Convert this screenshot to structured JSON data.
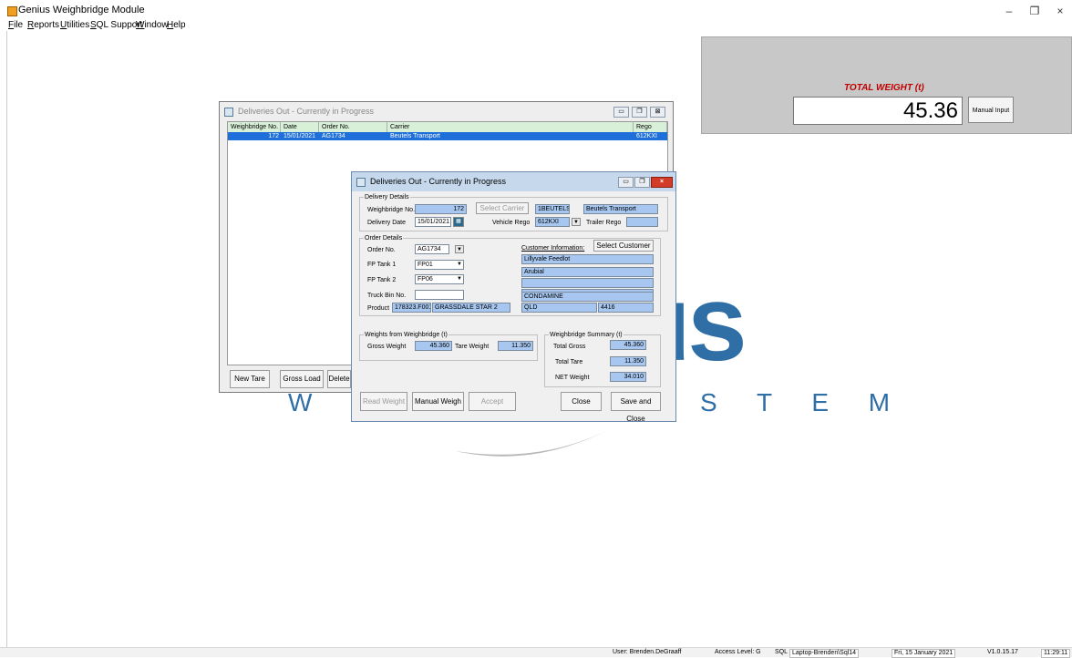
{
  "app": {
    "title": "Genius Weighbridge Module",
    "controls": {
      "minimize": "–",
      "restore": "❐",
      "close": "×"
    }
  },
  "menu": [
    "File",
    "Reports",
    "Utilities",
    "SQL Support",
    "Window",
    "Help"
  ],
  "weight_panel": {
    "label": "TOTAL WEIGHT (t)",
    "value": "45.36",
    "manual_input": "Manual Input"
  },
  "background_logo": {
    "fragment_us": "us",
    "fragment_w": "W E",
    "fragment_stem": "S T E M"
  },
  "list_window": {
    "title": "Deliveries Out - Currently in Progress",
    "columns": [
      "Weighbridge No.",
      "Date",
      "Order No.",
      "Carrier",
      "Rego"
    ],
    "rows": [
      {
        "weighbridge_no": "172",
        "date": "15/01/2021",
        "order_no": "AG1734",
        "carrier": "Beutels Transport",
        "rego": "612KXI"
      }
    ],
    "buttons": {
      "new_tare": "New Tare",
      "gross_load": "Gross Load",
      "delete": "Delete"
    }
  },
  "dialog": {
    "title": "Deliveries Out - Currently in Progress",
    "delivery_details": {
      "legend": "Delivery Details",
      "weighbridge_no_label": "Weighbridge No.",
      "weighbridge_no": "172",
      "select_carrier": "Select Carrier",
      "carrier_code": "1BEUTELS",
      "carrier_name": "Beutels Transport",
      "delivery_date_label": "Delivery Date",
      "delivery_date": "15/01/2021",
      "vehicle_rego_label": "Vehicle Rego",
      "vehicle_rego": "612KXI",
      "trailer_rego_label": "Trailer Rego",
      "trailer_rego": ""
    },
    "order_details": {
      "legend": "Order Details",
      "order_no_label": "Order No.",
      "order_no": "AG1734",
      "fp_tank1_label": "FP Tank 1",
      "fp_tank1": "FP01",
      "fp_tank2_label": "FP Tank 2",
      "fp_tank2": "FP06",
      "truck_bin_label": "Truck Bin No.",
      "truck_bin": "",
      "product_label": "Product",
      "product_code": "178323.F001",
      "product_name": "GRASSDALE STAR 2",
      "customer_info_label": "Customer Information:",
      "select_customer": "Select Customer",
      "customer_lines": [
        "Lillyvale Feedlot",
        "Arubial",
        "",
        "",
        "CONDAMINE"
      ],
      "state": "QLD",
      "postcode": "4416"
    },
    "weights": {
      "legend": "Weights from Weighbridge (t)",
      "gross_label": "Gross Weight",
      "gross": "45.360",
      "tare_label": "Tare Weight",
      "tare": "11.350"
    },
    "summary": {
      "legend": "Weighbridge Summary (t)",
      "total_gross_label": "Total Gross",
      "total_gross": "45.360",
      "total_tare_label": "Total Tare",
      "total_tare": "11.350",
      "net_label": "NET Weight",
      "net": "34.010"
    },
    "buttons": {
      "read_weight": "Read Weight",
      "manual_weigh": "Manual Weigh",
      "accept": "Accept",
      "close": "Close",
      "save_close": "Save and Close"
    }
  },
  "status": {
    "user": "User: Brenden.DeGraaff",
    "access": "Access Level: G",
    "sql_label": "SQL",
    "sql_server": "Laptop-Brenden\\Sql14",
    "date": "Fri, 15 January 2021",
    "version": "V1.0.15.17",
    "time": "11:29:11"
  }
}
